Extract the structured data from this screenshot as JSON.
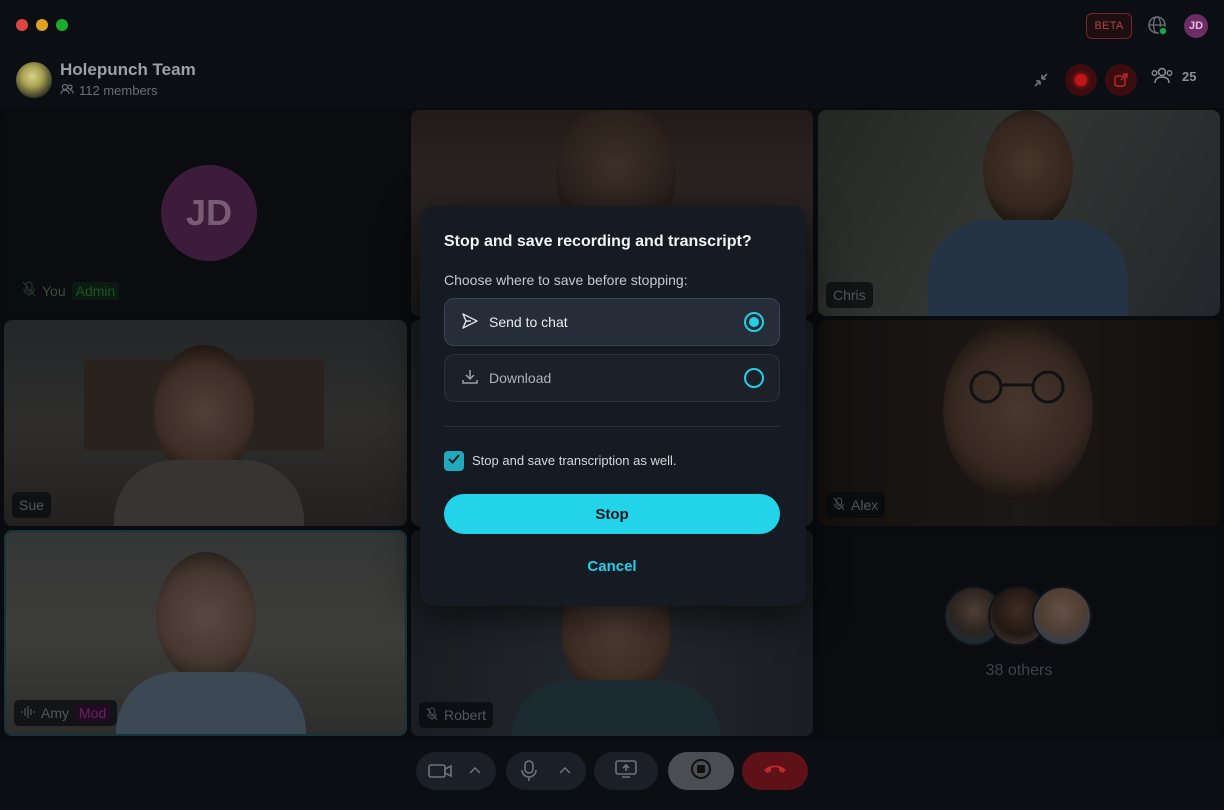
{
  "window": {
    "traffic_lights": [
      "#e0443e",
      "#dea123",
      "#1aab29"
    ],
    "beta_badge": "BETA",
    "user_initials": "JD"
  },
  "header": {
    "team_name": "Holepunch Team",
    "members": "112 members",
    "participant_count": "25",
    "icons": [
      "minimize-icon",
      "record-icon",
      "share-icon",
      "participants-icon"
    ]
  },
  "tiles": {
    "you": {
      "initials": "JD",
      "name": "You",
      "role": "Admin"
    },
    "chris": {
      "name": "Chris"
    },
    "sue": {
      "name": "Sue"
    },
    "alex": {
      "name": "Alex"
    },
    "amy": {
      "name": "Amy",
      "role": "Mod"
    },
    "robert": {
      "name": "Robert"
    },
    "others": {
      "label": "38 others"
    }
  },
  "controls": {
    "icons": [
      "camera-icon",
      "chevron-up-icon",
      "microphone-icon",
      "chevron-up-icon",
      "screen-share-icon",
      "stop-record-icon",
      "hang-up-icon"
    ]
  },
  "modal": {
    "title": "Stop and save recording and transcript?",
    "subtitle": "Choose where to save before stopping:",
    "options": [
      {
        "label": "Send to chat",
        "selected": true
      },
      {
        "label": "Download",
        "selected": false
      }
    ],
    "checkbox_label": "Stop and save transcription as well.",
    "checkbox_checked": true,
    "stop_label": "Stop",
    "cancel_label": "Cancel",
    "accent_color": "#22d3ea"
  }
}
